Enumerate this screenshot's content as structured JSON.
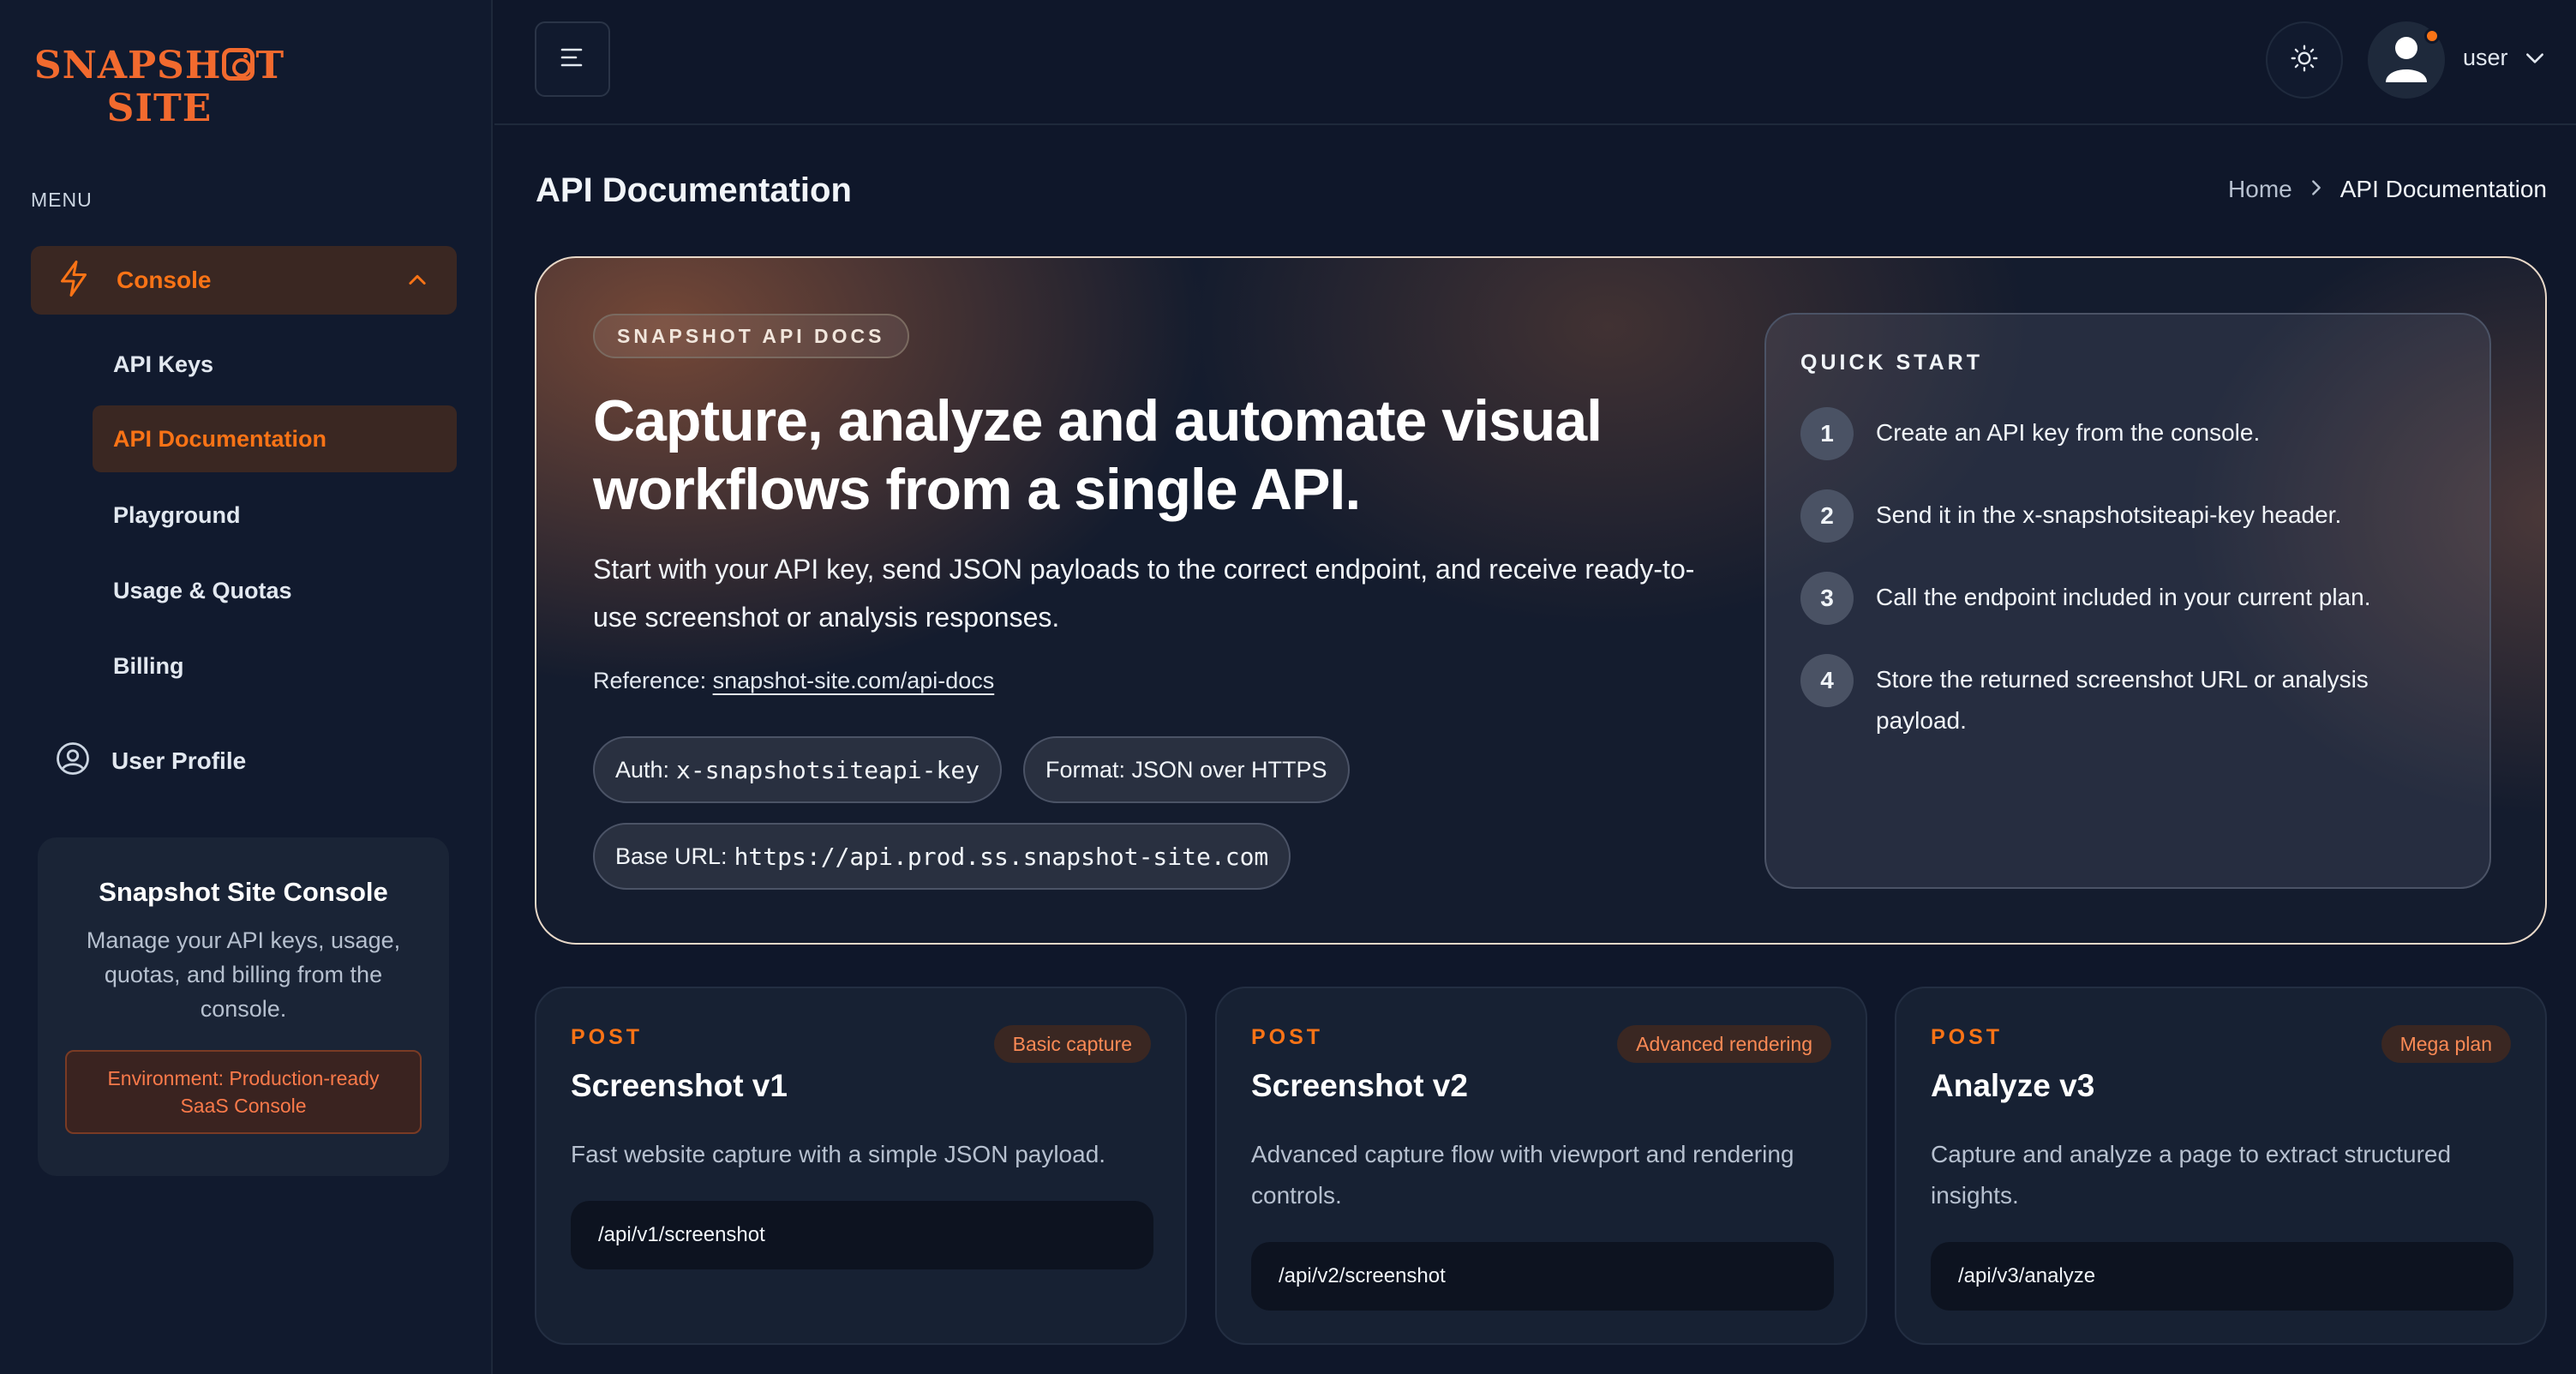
{
  "sidebar": {
    "logo_line1": "SNAPSH",
    "logo_line1_end": "T",
    "logo_line2": "SITE",
    "menu_label": "MENU",
    "console_label": "Console",
    "items": [
      {
        "label": "API Keys",
        "active": false
      },
      {
        "label": "API Documentation",
        "active": true
      },
      {
        "label": "Playground",
        "active": false
      },
      {
        "label": "Usage & Quotas",
        "active": false
      },
      {
        "label": "Billing",
        "active": false
      }
    ],
    "profile_label": "User Profile",
    "promo": {
      "title": "Snapshot Site Console",
      "text": "Manage your API keys, usage, quotas, and billing from the console.",
      "env": "Environment: Production-ready SaaS Console"
    }
  },
  "topbar": {
    "user_name": "user"
  },
  "page": {
    "title": "API Documentation",
    "breadcrumb": {
      "home": "Home",
      "current": "API Documentation"
    }
  },
  "hero": {
    "badge": "SNAPSHOT API DOCS",
    "title": "Capture, analyze and automate visual workflows from a single API.",
    "description": "Start with your API key, send JSON payloads to the correct endpoint, and receive ready-to-use screenshot or analysis responses.",
    "reference_label": "Reference:",
    "reference_link": "snapshot-site.com/api-docs",
    "auth_label": "Auth:",
    "auth_value": "x-snapshotsiteapi-key",
    "format_label": "Format: JSON over HTTPS",
    "base_url_label": "Base URL:",
    "base_url_value": "https://api.prod.ss.snapshot-site.com",
    "quick_start": {
      "label": "QUICK START",
      "steps": [
        {
          "num": "1",
          "text": "Create an API key from the console."
        },
        {
          "num": "2",
          "text": "Send it in the x-snapshotsiteapi-key header."
        },
        {
          "num": "3",
          "text": "Call the endpoint included in your current plan."
        },
        {
          "num": "4",
          "text": "Store the returned screenshot URL or analysis payload."
        }
      ]
    }
  },
  "endpoints": [
    {
      "method": "POST",
      "tag": "Basic capture",
      "name": "Screenshot v1",
      "description": "Fast website capture with a simple JSON payload.",
      "path": "/api/v1/screenshot"
    },
    {
      "method": "POST",
      "tag": "Advanced rendering",
      "name": "Screenshot v2",
      "description": "Advanced capture flow with viewport and rendering controls.",
      "path": "/api/v2/screenshot"
    },
    {
      "method": "POST",
      "tag": "Mega plan",
      "name": "Analyze v3",
      "description": "Capture and analyze a page to extract structured insights.",
      "path": "/api/v3/analyze"
    }
  ],
  "colors": {
    "accent": "#f97316",
    "background": "#0f172a",
    "sidebar": "#111a2e",
    "card": "#172133"
  },
  "icons": {
    "console": "lightning-icon",
    "profile": "user-circle-icon",
    "menu": "hamburger-icon",
    "theme": "sun-icon",
    "avatar": "user-avatar-icon"
  }
}
